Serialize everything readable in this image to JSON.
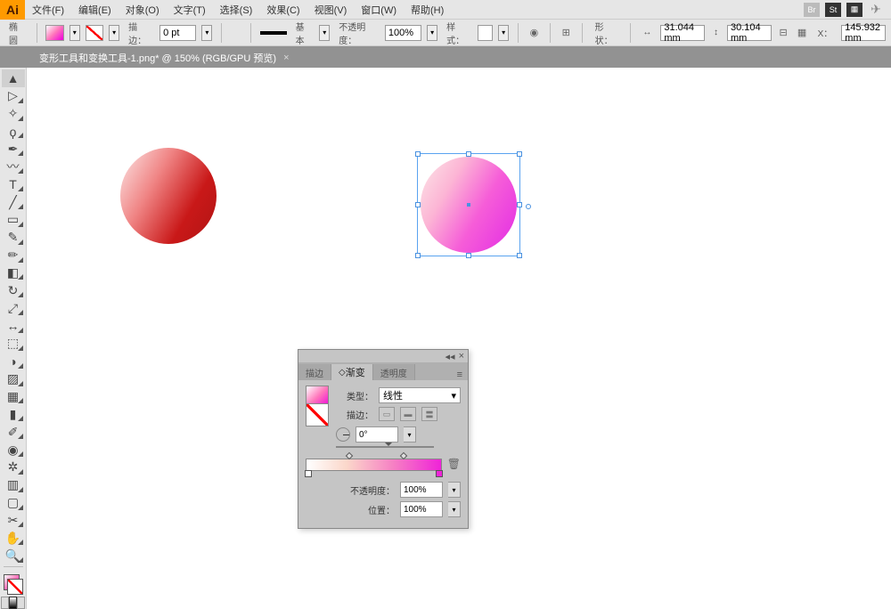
{
  "app": {
    "name": "Ai"
  },
  "menu": [
    "文件(F)",
    "编辑(E)",
    "对象(O)",
    "文字(T)",
    "选择(S)",
    "效果(C)",
    "视图(V)",
    "窗口(W)",
    "帮助(H)"
  ],
  "control": {
    "shape_label": "椭圆",
    "stroke_label": "描边：",
    "stroke_pt": "0 pt",
    "brush_label": "基本",
    "opacity_label": "不透明度：",
    "opacity_value": "100%",
    "style_label": "样式：",
    "shape_btn": "形状：",
    "width_icon": "↔",
    "width_val": "31.044 mm",
    "height_icon": "↕",
    "height_val": "30.104 mm",
    "x_label": "X：",
    "x_val": "145.932 mm"
  },
  "doc": {
    "title": "变形工具和变换工具-1.png* @ 150% (RGB/GPU 预览)"
  },
  "panel": {
    "tabs": {
      "stroke": "描边",
      "gradient": "渐变",
      "transparency": "透明度"
    },
    "type_label": "类型：",
    "type_value": "线性",
    "stroke_row_label": "描边：",
    "angle_value": "0°",
    "opacity_label": "不透明度：",
    "opacity_value": "100%",
    "position_label": "位置：",
    "position_value": "100%"
  }
}
